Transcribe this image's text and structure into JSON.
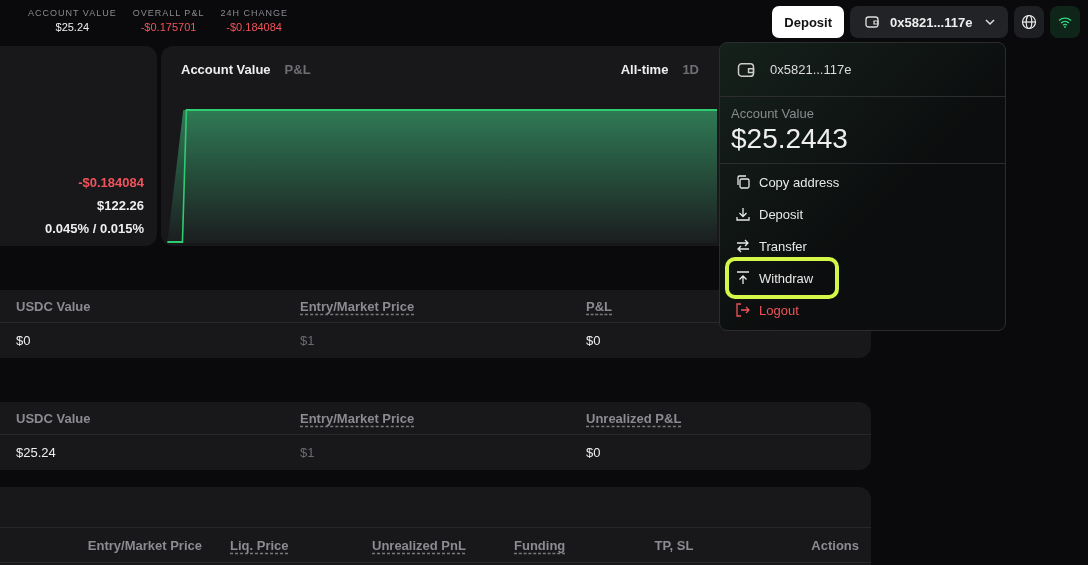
{
  "stats": [
    {
      "label": "ACCOUNT VALUE",
      "value": "$25.24",
      "negative": false
    },
    {
      "label": "OVERALL P&L",
      "value": "-$0.175701",
      "negative": true
    },
    {
      "label": "24H CHANGE",
      "value": "-$0.184084",
      "negative": true
    }
  ],
  "header": {
    "deposit_button": "Deposit",
    "wallet_button": "0x5821...117e"
  },
  "summary_card": {
    "values": [
      {
        "text": "-$0.184084",
        "negative": true
      },
      {
        "text": "$122.26",
        "negative": false
      },
      {
        "text": "0.045% / 0.015%",
        "negative": false
      }
    ]
  },
  "chart_card": {
    "tabs": [
      {
        "label": "Account Value",
        "selected": true
      },
      {
        "label": "P&L",
        "selected": false
      }
    ],
    "ranges": [
      {
        "label": "All-time",
        "selected": true
      },
      {
        "label": "1D",
        "selected": false
      }
    ]
  },
  "tables": [
    {
      "columns": [
        {
          "label": "USDC Value",
          "dotted": false
        },
        {
          "label": "Entry/Market Price",
          "dotted": true
        },
        {
          "label": "P&L",
          "dotted": true
        }
      ],
      "rows": [
        [
          "$0",
          "$1",
          "$0"
        ]
      ]
    },
    {
      "columns": [
        {
          "label": "USDC Value",
          "dotted": false
        },
        {
          "label": "Entry/Market Price",
          "dotted": true
        },
        {
          "label": "Unrealized P&L",
          "dotted": true
        }
      ],
      "rows": [
        [
          "$25.24",
          "$1",
          "$0"
        ]
      ]
    }
  ],
  "positions_table": {
    "columns": [
      {
        "label": "Entry/Market Price",
        "dotted": false
      },
      {
        "label": "Liq. Price",
        "dotted": true
      },
      {
        "label": "Unrealized PnL",
        "dotted": true
      },
      {
        "label": "Funding",
        "dotted": true
      },
      {
        "label": "TP, SL",
        "dotted": false
      },
      {
        "label": "Actions",
        "dotted": false
      }
    ]
  },
  "dropdown": {
    "address": "0x5821...117e",
    "value_label": "Account Value",
    "value": "$25.2443",
    "items": [
      {
        "kind": "copy",
        "label": "Copy address",
        "highlighted": false
      },
      {
        "kind": "deposit",
        "label": "Deposit",
        "highlighted": false
      },
      {
        "kind": "transfer",
        "label": "Transfer",
        "highlighted": false
      },
      {
        "kind": "withdraw",
        "label": "Withdraw",
        "highlighted": true
      },
      {
        "kind": "logout",
        "label": "Logout",
        "highlighted": false
      }
    ]
  }
}
